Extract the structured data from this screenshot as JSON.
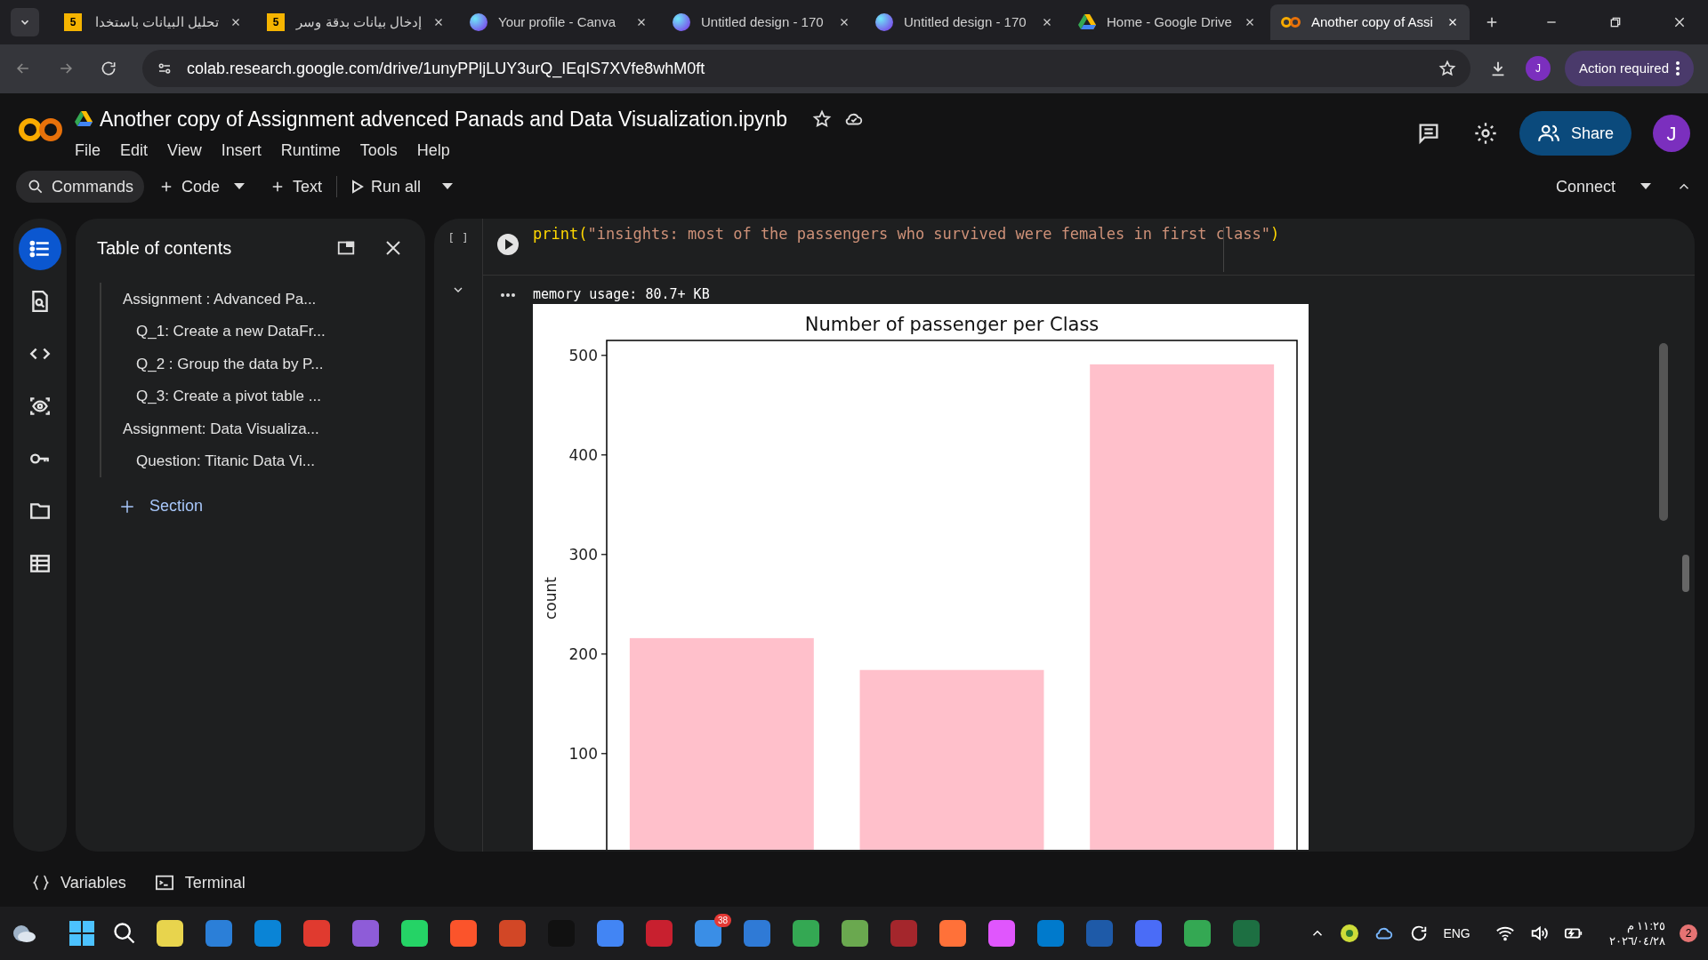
{
  "browser": {
    "tabs": [
      {
        "title": "تحليل البيانات باستخدا",
        "kind": "number",
        "icon_text": "5",
        "selected": false
      },
      {
        "title": "إدخال بيانات بدقة وسر",
        "kind": "number",
        "icon_text": "5",
        "selected": false
      },
      {
        "title": "Your profile - Canva",
        "kind": "canva",
        "selected": false
      },
      {
        "title": "Untitled design - 170",
        "kind": "canva",
        "selected": false
      },
      {
        "title": "Untitled design - 170",
        "kind": "canva",
        "selected": false
      },
      {
        "title": "Home - Google Drive",
        "kind": "drive",
        "selected": false
      },
      {
        "title": "Another copy of Assi",
        "kind": "colab",
        "selected": true
      }
    ],
    "url": "colab.research.google.com/drive/1unyPPljLUY3urQ_IEqIS7XVfe8whM0ft",
    "profile": "J",
    "action": "Action required"
  },
  "notebook": {
    "title": "Another copy of Assignment advenced Panads and Data Visualization.ipynb",
    "menu": [
      "File",
      "Edit",
      "View",
      "Insert",
      "Runtime",
      "Tools",
      "Help"
    ],
    "share": "Share",
    "avatar": "J"
  },
  "toolbar": {
    "commands": "Commands",
    "code": "Code",
    "text": "Text",
    "run_all": "Run all",
    "connect": "Connect"
  },
  "rail": [
    {
      "kind": "toc",
      "selected": true
    },
    {
      "kind": "find",
      "selected": false
    },
    {
      "kind": "code",
      "selected": false
    },
    {
      "kind": "eye",
      "selected": false
    },
    {
      "kind": "key",
      "selected": false
    },
    {
      "kind": "folder",
      "selected": false
    },
    {
      "kind": "table",
      "selected": false
    }
  ],
  "toc": {
    "title": "Table of contents",
    "items": [
      {
        "text": "Assignment : Advanced Pa...",
        "children": [
          {
            "text": "Q_1: Create a new DataFr..."
          },
          {
            "text": "Q_2 : Group the data by P..."
          },
          {
            "text": "Q_3: Create a pivot table ..."
          }
        ]
      },
      {
        "text": "Assignment: Data Visualiza...",
        "children": [
          {
            "text": "Question: Titanic Data Vi..."
          }
        ]
      }
    ],
    "add_section": "Section"
  },
  "cell": {
    "exec_count": "[ ]",
    "code": [
      {
        "kind": "plain",
        "text": "print("
      },
      {
        "kind": "string",
        "text": "\"insights: most of the passengers who survived were females in first class\""
      },
      {
        "kind": "plain",
        "text": ")"
      }
    ],
    "output_text": "memory usage: 80.7+ KB",
    "chart_data": {
      "type": "bar",
      "title": "Number of passenger per Class",
      "ylabel": "count",
      "categories": [
        null,
        null,
        null
      ],
      "series": [
        {
          "color": "#ffc0cb",
          "values": [
            216,
            184,
            491
          ]
        }
      ],
      "yticks": [
        100,
        200,
        300,
        400,
        500
      ],
      "ylim": [
        0,
        515
      ]
    }
  },
  "bottom": {
    "variables": "Variables",
    "terminal": "Terminal"
  },
  "taskbar": {
    "apps": [
      {
        "color": "#e8d44d"
      },
      {
        "color": "#2b7fd8"
      },
      {
        "color": "#0a84d6"
      },
      {
        "color": "#e03a2f"
      },
      {
        "color": "#8e5cd8"
      },
      {
        "color": "#25d366"
      },
      {
        "color": "#fb542b"
      },
      {
        "color": "#d24726"
      },
      {
        "color": "#111111"
      },
      {
        "color": "#4285f4"
      },
      {
        "color": "#c8202f"
      },
      {
        "color": "#3a8ee6"
      },
      {
        "color": "#2f7ad6"
      },
      {
        "color": "#34a853"
      },
      {
        "color": "#6aa84f"
      },
      {
        "color": "#a4262c"
      },
      {
        "color": "#ff7139"
      },
      {
        "color": "#e056fd"
      },
      {
        "color": "#007acc"
      },
      {
        "color": "#1e5aa8"
      },
      {
        "color": "#4a6cf7"
      },
      {
        "color": "#34a853"
      },
      {
        "color": "#1d6f42"
      }
    ],
    "badge": "38",
    "lang": "ENG",
    "time": "١١:٢٥ م",
    "date": "٢٠٢٦/٠٤/٢٨",
    "notifications": "2"
  }
}
